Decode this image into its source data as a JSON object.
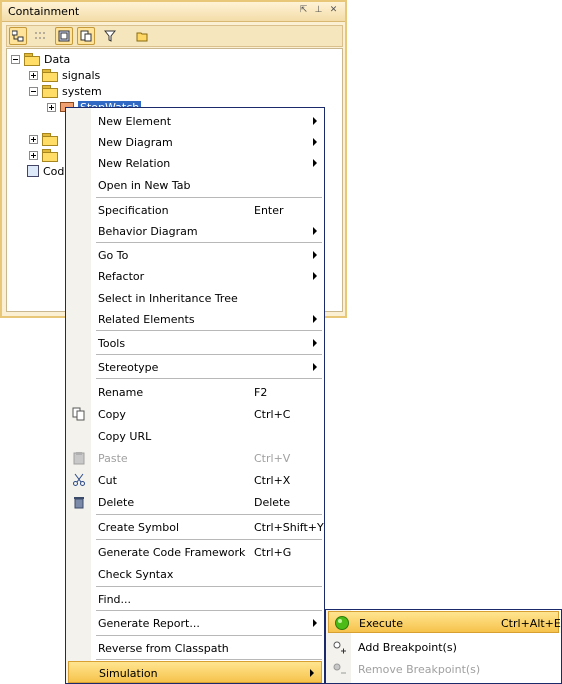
{
  "panel": {
    "title": "Containment",
    "tree": [
      {
        "label": "Data"
      },
      {
        "label": "signals"
      },
      {
        "label": "system"
      },
      {
        "label": "StopWatch"
      },
      {
        "label": "Code"
      }
    ]
  },
  "menu": {
    "items": [
      {
        "label": "New Element",
        "shortcut": ""
      },
      {
        "label": "New Diagram",
        "shortcut": ""
      },
      {
        "label": "New Relation",
        "shortcut": ""
      },
      {
        "label": "Open in New Tab",
        "shortcut": ""
      },
      {
        "label": "Specification",
        "shortcut": "Enter"
      },
      {
        "label": "Behavior Diagram",
        "shortcut": ""
      },
      {
        "label": "Go To",
        "shortcut": ""
      },
      {
        "label": "Refactor",
        "shortcut": ""
      },
      {
        "label": "Select in Inheritance Tree",
        "shortcut": ""
      },
      {
        "label": "Related Elements",
        "shortcut": ""
      },
      {
        "label": "Tools",
        "shortcut": ""
      },
      {
        "label": "Stereotype",
        "shortcut": ""
      },
      {
        "label": "Rename",
        "shortcut": "F2"
      },
      {
        "label": "Copy",
        "shortcut": "Ctrl+C"
      },
      {
        "label": "Copy URL",
        "shortcut": ""
      },
      {
        "label": "Paste",
        "shortcut": "Ctrl+V"
      },
      {
        "label": "Cut",
        "shortcut": "Ctrl+X"
      },
      {
        "label": "Delete",
        "shortcut": "Delete"
      },
      {
        "label": "Create Symbol",
        "shortcut": "Ctrl+Shift+Y"
      },
      {
        "label": "Generate Code Framework",
        "shortcut": "Ctrl+G"
      },
      {
        "label": "Check Syntax",
        "shortcut": ""
      },
      {
        "label": "Find...",
        "shortcut": ""
      },
      {
        "label": "Generate Report...",
        "shortcut": ""
      },
      {
        "label": "Reverse from Classpath",
        "shortcut": ""
      },
      {
        "label": "Simulation",
        "shortcut": ""
      }
    ]
  },
  "submenu": {
    "items": [
      {
        "label": "Execute",
        "shortcut": "Ctrl+Alt+E"
      },
      {
        "label": "Add Breakpoint(s)",
        "shortcut": ""
      },
      {
        "label": "Remove Breakpoint(s)",
        "shortcut": ""
      }
    ]
  },
  "colors": {
    "highlight": "#f6c34c",
    "panel_bg": "#fcf0d4",
    "menu_border": "#1a2a6a",
    "execute_icon": "#4cbb17"
  }
}
